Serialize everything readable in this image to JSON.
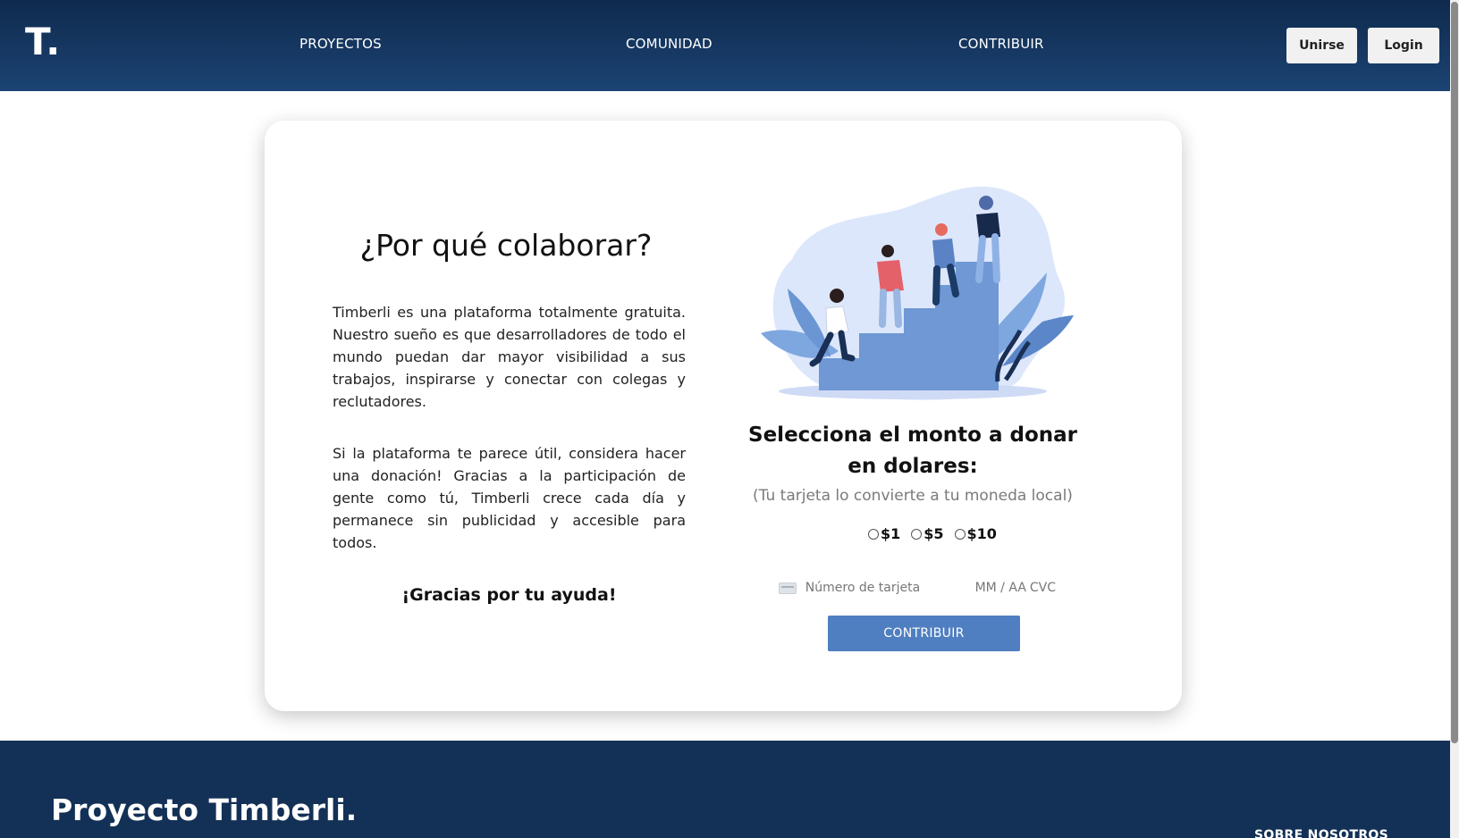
{
  "header": {
    "logo": "T.",
    "nav": [
      "PROYECTOS",
      "COMUNIDAD",
      "CONTRIBUIR"
    ],
    "join_label": "Unirse",
    "login_label": "Login"
  },
  "main": {
    "title": "¿Por qué colaborar?",
    "paragraphs": [
      "Timberli es una plataforma totalmente gratuita. Nuestro sueño es que desarrolladores de todo el mundo puedan dar mayor visibilidad a sus trabajos, inspirarse y conectar con colegas y reclutadores.",
      "Si la plataforma te parece útil, considera hacer una donación! Gracias a la participación de gente como tú, Timberli crece cada día y permanece sin publicidad y accesible para todos."
    ],
    "thanks": "¡Gracias por tu ayuda!"
  },
  "donation": {
    "title": "Selecciona el monto a donar en dolares:",
    "note": "(Tu tarjeta lo convierte a tu moneda local)",
    "amounts": [
      "$1",
      "$5",
      "$10"
    ],
    "card_number_placeholder": "Número de tarjeta",
    "expiry_placeholder": "MM / AA",
    "cvc_placeholder": "CVC",
    "button_label": "CONTRIBUIR"
  },
  "footer": {
    "title": "Proyecto Timberli.",
    "link": "SOBRE NOSOTROS"
  },
  "colors": {
    "header_bg": "#163a66",
    "button_blue": "#4f7fc1",
    "footer_bg": "#133156"
  },
  "icons": {
    "card": "credit-card-icon"
  }
}
